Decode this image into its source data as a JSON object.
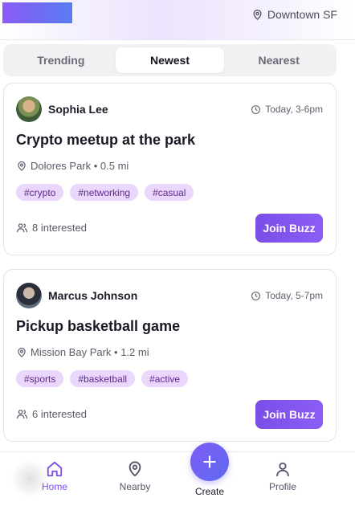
{
  "header": {
    "location": "Downtown SF",
    "location_icon": "map-pin-icon"
  },
  "tabs": [
    {
      "label": "Trending",
      "active": false
    },
    {
      "label": "Newest",
      "active": true
    },
    {
      "label": "Nearest",
      "active": false
    }
  ],
  "events": [
    {
      "author": "Sophia Lee",
      "time": "Today, 3-6pm",
      "title": "Crypto meetup at the park",
      "place": "Dolores Park • 0.5 mi",
      "tags": [
        "#crypto",
        "#networking",
        "#casual"
      ],
      "interested": "8 interested",
      "join_label": "Join Buzz"
    },
    {
      "author": "Marcus Johnson",
      "time": "Today, 5-7pm",
      "title": "Pickup basketball game",
      "place": "Mission Bay Park • 1.2 mi",
      "tags": [
        "#sports",
        "#basketball",
        "#active"
      ],
      "interested": "6 interested",
      "join_label": "Join Buzz"
    }
  ],
  "nav": {
    "home": "Home",
    "nearby": "Nearby",
    "create": "Create",
    "profile": "Profile"
  },
  "colors": {
    "accent": "#7c4ee8",
    "tag_bg": "#ead7fb",
    "tag_text": "#5b2a8a"
  }
}
